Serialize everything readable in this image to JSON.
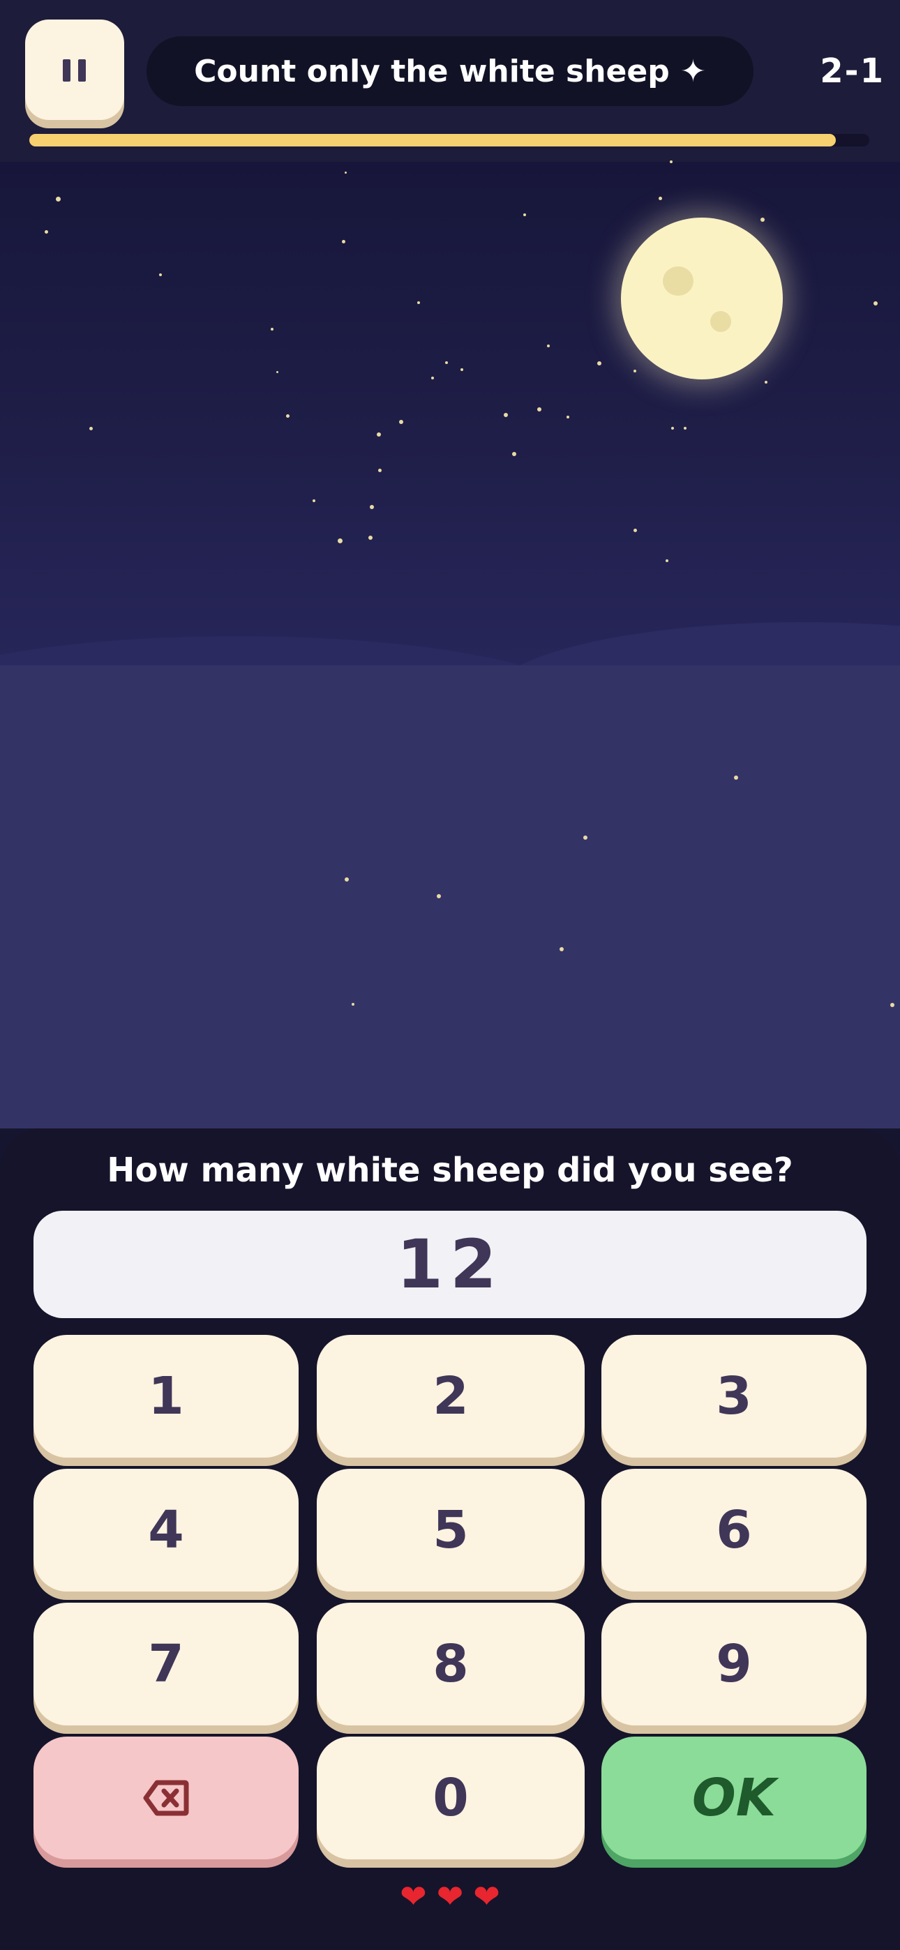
{
  "header": {
    "pause_icon": "pause-icon",
    "instruction": "Count only the white sheep ✦",
    "level": "2-1",
    "progress": 0.96,
    "progress_color": "#f7d070"
  },
  "scene": {
    "moon_color": "#fbf2c4"
  },
  "answer": {
    "question": "How many white sheep did you see?",
    "value": "12",
    "keys": [
      "1",
      "2",
      "3",
      "4",
      "5",
      "6",
      "7",
      "8",
      "9",
      "0"
    ],
    "delete_icon": "backspace-icon",
    "ok_label": "OK"
  },
  "lives": {
    "count": 3,
    "icon": "heart-icon",
    "hearts": [
      "❤",
      "❤",
      "❤"
    ]
  }
}
